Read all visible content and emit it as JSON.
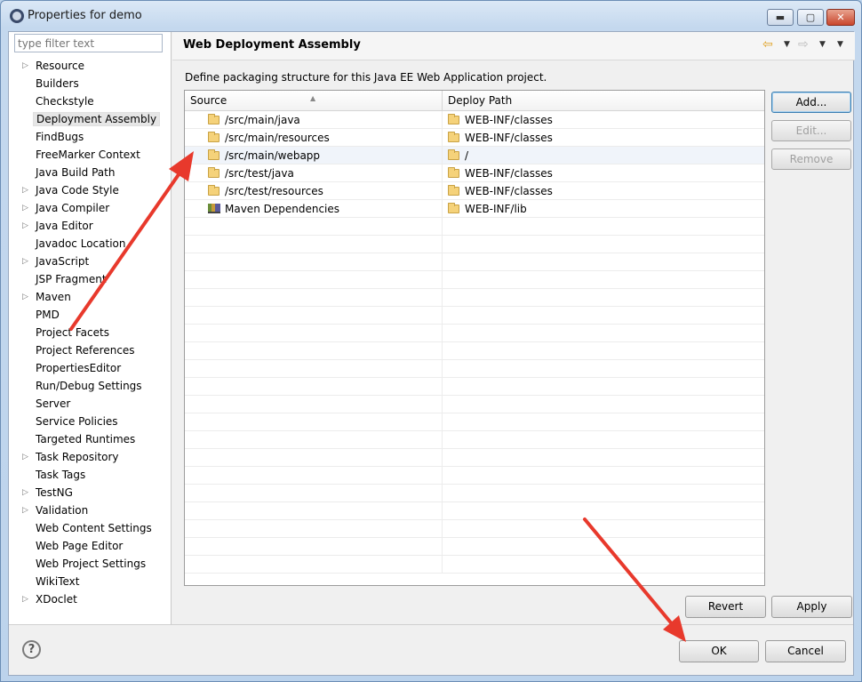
{
  "window": {
    "title": "Properties for demo",
    "min_glyph": "▬",
    "max_glyph": "▢",
    "close_glyph": "✕"
  },
  "filter": {
    "placeholder": "type filter text"
  },
  "tree": {
    "items": [
      {
        "label": "Resource",
        "expandable": true
      },
      {
        "label": "Builders",
        "expandable": false
      },
      {
        "label": "Checkstyle",
        "expandable": false
      },
      {
        "label": "Deployment Assembly",
        "expandable": false,
        "selected": true
      },
      {
        "label": "FindBugs",
        "expandable": false
      },
      {
        "label": "FreeMarker Context",
        "expandable": false
      },
      {
        "label": "Java Build Path",
        "expandable": false
      },
      {
        "label": "Java Code Style",
        "expandable": true
      },
      {
        "label": "Java Compiler",
        "expandable": true
      },
      {
        "label": "Java Editor",
        "expandable": true
      },
      {
        "label": "Javadoc Location",
        "expandable": false
      },
      {
        "label": "JavaScript",
        "expandable": true
      },
      {
        "label": "JSP Fragment",
        "expandable": false
      },
      {
        "label": "Maven",
        "expandable": true
      },
      {
        "label": "PMD",
        "expandable": false
      },
      {
        "label": "Project Facets",
        "expandable": false
      },
      {
        "label": "Project References",
        "expandable": false
      },
      {
        "label": "PropertiesEditor",
        "expandable": false
      },
      {
        "label": "Run/Debug Settings",
        "expandable": false
      },
      {
        "label": "Server",
        "expandable": false
      },
      {
        "label": "Service Policies",
        "expandable": false
      },
      {
        "label": "Targeted Runtimes",
        "expandable": false
      },
      {
        "label": "Task Repository",
        "expandable": true
      },
      {
        "label": "Task Tags",
        "expandable": false
      },
      {
        "label": "TestNG",
        "expandable": true
      },
      {
        "label": "Validation",
        "expandable": true
      },
      {
        "label": "Web Content Settings",
        "expandable": false
      },
      {
        "label": "Web Page Editor",
        "expandable": false
      },
      {
        "label": "Web Project Settings",
        "expandable": false
      },
      {
        "label": "WikiText",
        "expandable": false
      },
      {
        "label": "XDoclet",
        "expandable": true
      }
    ]
  },
  "page": {
    "title": "Web Deployment Assembly",
    "description": "Define packaging structure for this Java EE Web Application project.",
    "nav_back_glyph": "⇦",
    "nav_fwd_glyph": "⇨",
    "dropdown_glyph": "▼"
  },
  "table": {
    "columns": [
      "Source",
      "Deploy Path"
    ],
    "sort_glyph": "▲",
    "rows": [
      {
        "source": "/src/main/java",
        "deploy": "WEB-INF/classes",
        "icon": "folder-icon"
      },
      {
        "source": "/src/main/resources",
        "deploy": "WEB-INF/classes",
        "icon": "folder-icon"
      },
      {
        "source": "/src/main/webapp",
        "deploy": "/",
        "icon": "folder-icon",
        "selected": true
      },
      {
        "source": "/src/test/java",
        "deploy": "WEB-INF/classes",
        "icon": "folder-icon"
      },
      {
        "source": "/src/test/resources",
        "deploy": "WEB-INF/classes",
        "icon": "folder-icon"
      },
      {
        "source": "Maven Dependencies",
        "deploy": "WEB-INF/lib",
        "icon": "library-icon"
      }
    ]
  },
  "buttons": {
    "add": "Add...",
    "edit": "Edit...",
    "remove": "Remove",
    "revert": "Revert",
    "apply": "Apply",
    "ok": "OK",
    "cancel": "Cancel",
    "help": "?"
  },
  "colors": {
    "annotation_arrow": "#e8392c"
  }
}
